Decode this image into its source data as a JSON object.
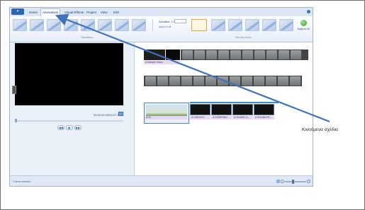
{
  "ribbon": {
    "file_label": "",
    "tabs": [
      "Home",
      "Animations",
      "Visual Effects",
      "Project",
      "View",
      "Edit"
    ],
    "active_tab": "Animations",
    "duration_label": "Duration: 1.50",
    "apply_all_label": "Apply to all",
    "transitions_group": "Transitions",
    "pan_zoom_group": "Pan and zoom",
    "apply_to_all_label": "Apply to all"
  },
  "preview": {
    "timecode": "00:00:00.00/02:27.22",
    "prev_label": "◀◀",
    "play_label": "▶",
    "next_label": "▶▶"
  },
  "storyboard": {
    "title_clip": "A Sample Video",
    "clip_labels": [
      "A W...",
      "A CREDITS",
      "A STARRING",
      "A FILMED O...",
      "A SOUNDTR..."
    ]
  },
  "status": {
    "text": "9 items selected"
  },
  "annotation": {
    "text": "Κινούμενα σχέδια"
  },
  "colors": {
    "arrow": "#3f72b8",
    "accent": "#2f66b3"
  }
}
